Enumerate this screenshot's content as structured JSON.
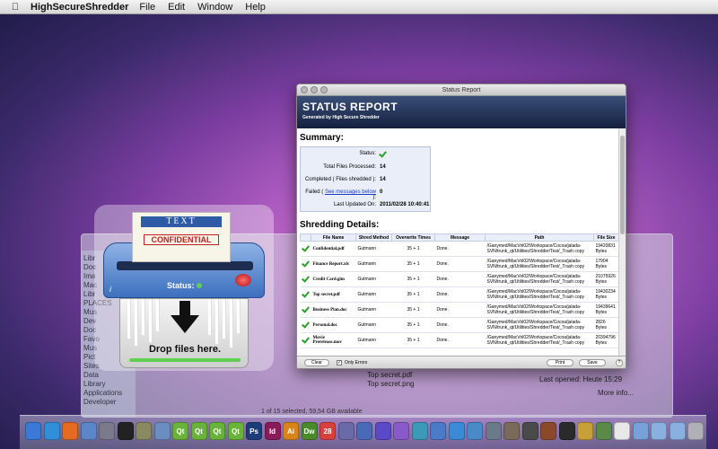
{
  "menubar": {
    "app_name": "HighSecureShredder",
    "items": [
      "File",
      "Edit",
      "Window",
      "Help"
    ]
  },
  "finder": {
    "sidebar": [
      "Libr",
      "Doc",
      "Ima",
      "Mac",
      "Libr",
      "PLACES",
      "Mus",
      "Dev",
      "Doc",
      "Favo",
      "Mus",
      "Pict",
      "Sites",
      "Data",
      "Library",
      "Applications",
      "Developer"
    ],
    "files": [
      "Top secret.pdf",
      "Top secret.png"
    ],
    "last_opened": "Last opened: Heute 15:29",
    "more_info": "More info...",
    "footer": "1 of 15 selected, 59,54 GB available"
  },
  "shredder": {
    "paper_text": "TEXT",
    "paper_stamp": "CONFIDENTIAL",
    "status_label": "Status:",
    "info_label": "i",
    "drop_label": "Drop files here."
  },
  "report": {
    "window_title": "Status Report",
    "banner_title": "STATUS REPORT",
    "banner_sub": "Generated by High Secure Shredder",
    "summary_heading": "Summary:",
    "summary": {
      "status_label": "Status:",
      "total_label": "Total Files Processed:",
      "total_value": "14",
      "completed_label": "Completed ( Files shredded ):",
      "completed_value": "14",
      "failed_prefix": "Failed (",
      "failed_link": "See messages below",
      "failed_suffix": "):",
      "failed_value": "0",
      "updated_label": "Last Updated On:",
      "updated_value": "2011/02/28 10:40:41"
    },
    "details_heading": "Shredding Details:",
    "columns": [
      "File Name",
      "Shred Method",
      "Overwrite Times",
      "Message",
      "Path",
      "File Size"
    ],
    "rows": [
      {
        "file": "Confidential.pdf",
        "method": "Gutmann",
        "times": "35 + 1",
        "msg": "Done.",
        "path": "/Ganymed/MacVol02/Workspace/Cocoa/jalada-SVN/trunk_qt/Utilities/Shredder/Test/_Trash copy",
        "size": "19420831 Bytes"
      },
      {
        "file": "Finance Report.xls",
        "method": "Gutmann",
        "times": "35 + 1",
        "msg": "Done.",
        "path": "/Ganymed/MacVol02/Workspace/Cocoa/jalada-SVN/trunk_qt/Utilities/Shredder/Test/_Trash copy",
        "size": "17904 Bytes"
      },
      {
        "file": "Credit Card.gim",
        "method": "Gutmann",
        "times": "35 + 1",
        "msg": "Done.",
        "path": "/Ganymed/MacVol02/Workspace/Cocoa/jalada-SVN/trunk_qt/Utilities/Shredder/Test/_Trash copy",
        "size": "21075926 Bytes"
      },
      {
        "file": "Top secret.pdf",
        "method": "Gutmann",
        "times": "35 + 1",
        "msg": "Done.",
        "path": "/Ganymed/MacVol02/Workspace/Cocoa/jalada-SVN/trunk_qt/Utilities/Shredder/Test/_Trash copy",
        "size": "19430234 Bytes"
      },
      {
        "file": "Business Plan.doc",
        "method": "Gutmann",
        "times": "35 + 1",
        "msg": "Done.",
        "path": "/Ganymed/MacVol02/Workspace/Cocoa/jalada-SVN/trunk_qt/Utilities/Shredder/Test/_Trash copy",
        "size": "19439641 Bytes"
      },
      {
        "file": "Personal.doc",
        "method": "Gutmann",
        "times": "35 + 1",
        "msg": "Done.",
        "path": "/Ganymed/MacVol02/Workspace/Cocoa/jalada-SVN/trunk_qt/Utilities/Shredder/Test/_Trash copy",
        "size": "2826 Bytes"
      },
      {
        "file": "Movie Prerelease.mov",
        "method": "Gutmann",
        "times": "35 + 1",
        "msg": "Done.",
        "path": "/Ganymed/MacVol02/Workspace/Cocoa/jalada-SVN/trunk_qt/Utilities/Shredder/Test/_Trash copy",
        "size": "20394796 Bytes"
      }
    ],
    "buttons": {
      "clear": "Clear",
      "only_errors": "Only Errors",
      "print": "Print",
      "save": "Save",
      "help": "?"
    }
  },
  "dock": {
    "icons": [
      {
        "name": "finder-icon",
        "color": "#3a79d8",
        "label": ""
      },
      {
        "name": "safari-icon",
        "color": "#2f8fd8",
        "label": ""
      },
      {
        "name": "firefox-icon",
        "color": "#e46b1f",
        "label": ""
      },
      {
        "name": "mail-icon",
        "color": "#5b86c8",
        "label": ""
      },
      {
        "name": "system-icon",
        "color": "#7a7a8a",
        "label": ""
      },
      {
        "name": "terminal-icon",
        "color": "#222222",
        "label": ""
      },
      {
        "name": "editor-icon",
        "color": "#8a8a60",
        "label": ""
      },
      {
        "name": "xcode-icon",
        "color": "#6a8ec0",
        "label": ""
      },
      {
        "name": "qt-icon",
        "color": "#69b33a",
        "label": "Qt"
      },
      {
        "name": "qt-icon",
        "color": "#69b33a",
        "label": "Qt"
      },
      {
        "name": "qt-icon",
        "color": "#69b33a",
        "label": "Qt"
      },
      {
        "name": "qt-icon",
        "color": "#69b33a",
        "label": "Qt"
      },
      {
        "name": "photoshop-icon",
        "color": "#1d3d7a",
        "label": "Ps"
      },
      {
        "name": "indesign-icon",
        "color": "#8a1a5a",
        "label": "Id"
      },
      {
        "name": "illustrator-icon",
        "color": "#d9841a",
        "label": "Ai"
      },
      {
        "name": "dreamweaver-icon",
        "color": "#4a8a2a",
        "label": "Dw"
      },
      {
        "name": "calendar-icon",
        "color": "#d84040",
        "label": "28"
      },
      {
        "name": "app-icon",
        "color": "#6a6aa8",
        "label": ""
      },
      {
        "name": "app-icon",
        "color": "#4a6ab8",
        "label": ""
      },
      {
        "name": "app-icon",
        "color": "#5a4ac8",
        "label": ""
      },
      {
        "name": "app-icon",
        "color": "#8a5ac8",
        "label": ""
      },
      {
        "name": "app-icon",
        "color": "#3a9ab8",
        "label": ""
      },
      {
        "name": "app-icon",
        "color": "#4a7ac8",
        "label": ""
      },
      {
        "name": "itunes-icon",
        "color": "#3a8ad8",
        "label": ""
      },
      {
        "name": "app-icon",
        "color": "#4a8ac8",
        "label": ""
      },
      {
        "name": "app-icon",
        "color": "#6a7a8a",
        "label": ""
      },
      {
        "name": "app-icon",
        "color": "#7a6a5a",
        "label": ""
      },
      {
        "name": "app-icon",
        "color": "#4a4a4a",
        "label": ""
      },
      {
        "name": "app-icon",
        "color": "#8a4a2a",
        "label": ""
      },
      {
        "name": "app-icon",
        "color": "#2a2a2a",
        "label": ""
      },
      {
        "name": "app-icon",
        "color": "#c8a03a",
        "label": ""
      },
      {
        "name": "app-icon",
        "color": "#5a8a4a",
        "label": ""
      },
      {
        "name": "app-icon",
        "color": "#e8e8e8",
        "label": ""
      },
      {
        "name": "app-icon",
        "color": "#7aa0d8",
        "label": ""
      },
      {
        "name": "folder-icon",
        "color": "#8ab0e0",
        "label": ""
      },
      {
        "name": "folder-icon",
        "color": "#8ab0e0",
        "label": ""
      },
      {
        "name": "trash-icon",
        "color": "#b0b0b8",
        "label": ""
      }
    ]
  }
}
